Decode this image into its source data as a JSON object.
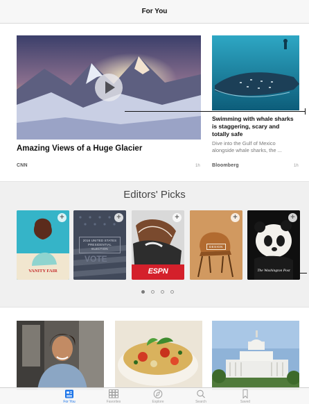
{
  "nav": {
    "title": "For You"
  },
  "hero": {
    "headline": "Amazing Views of a Huge Glacier",
    "source": "CNN",
    "age": "1h"
  },
  "side_story": {
    "headline": "Swimming with whale sharks is staggering, scary and totally safe",
    "summary": "Dive into the Gulf of Mexico alongside whale sharks, the ...",
    "source": "Bloomberg",
    "age": "1h"
  },
  "editors_picks": {
    "title": "Editors' Picks",
    "items": [
      {
        "label": "VANITY FAIR",
        "add": "+"
      },
      {
        "label": "2016 UNITED STATES PRESIDENTIAL ELECTION",
        "add": "+"
      },
      {
        "label": "ESPN",
        "add": "+"
      },
      {
        "label": "DESIGN",
        "add": "+"
      },
      {
        "label": "The Washington Post",
        "add": "+"
      }
    ],
    "page_count": 4,
    "current_page": 1
  },
  "tabbar": {
    "tabs": [
      {
        "label": "For You",
        "icon": "for-you-icon",
        "active": true
      },
      {
        "label": "Favorites",
        "icon": "favorites-grid-icon",
        "active": false
      },
      {
        "label": "Explore",
        "icon": "compass-icon",
        "active": false
      },
      {
        "label": "Search",
        "icon": "search-icon",
        "active": false
      },
      {
        "label": "Saved",
        "icon": "bookmark-icon",
        "active": false
      }
    ]
  },
  "colors": {
    "accent": "#1a73e8",
    "inactive": "#a0a0a0",
    "espn_red": "#d4202b",
    "wapo_bg": "#111111"
  }
}
